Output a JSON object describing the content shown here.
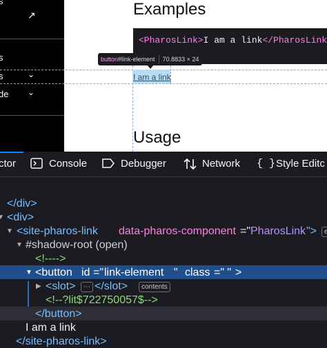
{
  "nav": {
    "text1": "s",
    "text2": "s",
    "text3": "de",
    "chev": "⌄",
    "arrow": "↗"
  },
  "page": {
    "heading_examples": "Examples",
    "code_open": "<PharosLink>",
    "code_text": "I am a link",
    "code_close": "</PharosLink>",
    "link_text": "I am a link",
    "heading_usage": "Usage"
  },
  "tooltip": {
    "tag": "button",
    "id": "#link-element",
    "size": "70.8833 × 24"
  },
  "tabs": [
    {
      "label": "ctor",
      "icon": ""
    },
    {
      "label": "Console",
      "icon": "console-icon"
    },
    {
      "label": "Debugger",
      "icon": "debugger-icon"
    },
    {
      "label": "Network",
      "icon": "network-icon"
    },
    {
      "label": "Style Editc",
      "icon": "style-editor-icon"
    }
  ],
  "tree": {
    "r1": "</div>",
    "r2": "<div>",
    "r3_open": "<site-pharos-link",
    "r3_attr": "data-pharos-component",
    "r3_eq": "=\"",
    "r3_val": "PharosLink",
    "r3_close": "\">",
    "r4": "#shadow-root (open)",
    "r5": "<!---->",
    "r6_open": "<button",
    "r6_attr1": "id",
    "r6_val1": "link-element",
    "r6_attr2": "class",
    "r6_val2": " ",
    "r6_close": ">",
    "r7_open": "<slot>",
    "r7_close": "</slot>",
    "r7_badge": "contents",
    "r8": "<!--?lit$722750057$-->",
    "r9": "</button>",
    "r10": "I am a link",
    "r11": "</site-pharos-link>"
  }
}
